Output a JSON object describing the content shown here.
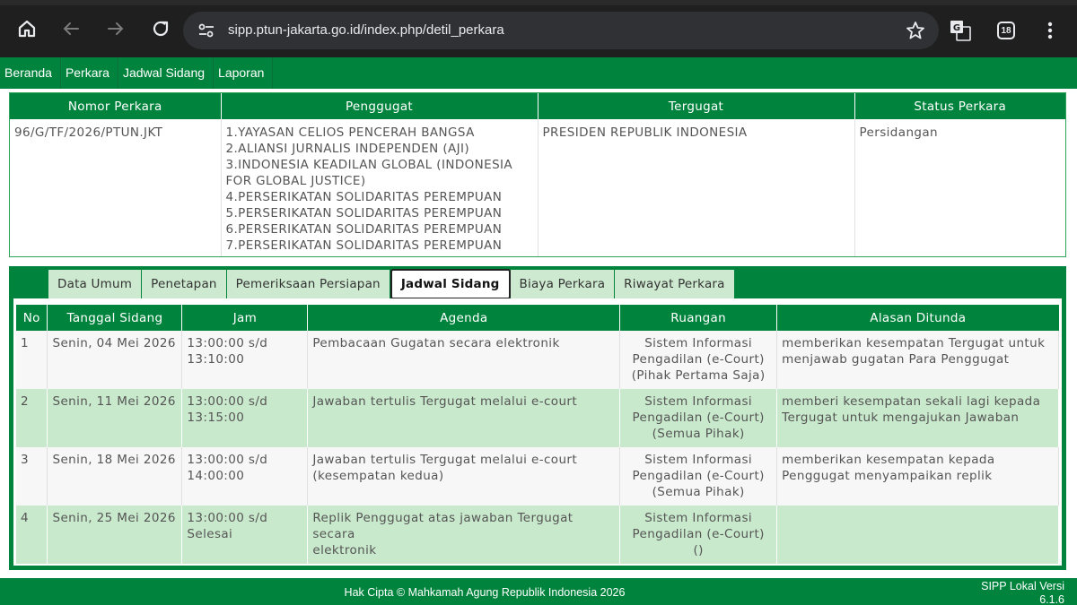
{
  "browser": {
    "url": "sipp.ptun-jakarta.go.id/index.php/detil_perkara",
    "tab_count": "18",
    "icons": [
      "home-icon",
      "back-icon",
      "forward-icon",
      "reload-icon",
      "site-settings-icon",
      "bookmark-star-icon",
      "translate-icon",
      "tab-count-icon",
      "menu-kebab-icon"
    ]
  },
  "nav": {
    "items": [
      "Beranda",
      "Perkara",
      "Jadwal Sidang",
      "Laporan"
    ]
  },
  "case": {
    "headers": [
      "Nomor Perkara",
      "Penggugat",
      "Tergugat",
      "Status Perkara"
    ],
    "nomor": "96/G/TF/2026/PTUN.JKT",
    "penggugat": [
      "1.YAYASAN CELIOS PENCERAH BANGSA",
      "2.ALIANSI JURNALIS INDEPENDEN (AJI)",
      "3.INDONESIA KEADILAN GLOBAL (INDONESIA",
      "FOR GLOBAL JUSTICE)",
      "4.PERSERIKATAN SOLIDARITAS PEREMPUAN",
      "5.PERSERIKATAN SOLIDARITAS PEREMPUAN",
      "6.PERSERIKATAN SOLIDARITAS PEREMPUAN",
      "7.PERSERIKATAN SOLIDARITAS PEREMPUAN"
    ],
    "tergugat": "PRESIDEN REPUBLIK INDONESIA",
    "status": "Persidangan"
  },
  "tabs": {
    "items": [
      "Data Umum",
      "Penetapan",
      "Pemeriksaan Persiapan",
      "Jadwal Sidang",
      "Biaya Perkara",
      "Riwayat Perkara"
    ],
    "active": "Jadwal Sidang"
  },
  "schedule": {
    "headers": [
      "No",
      "Tanggal Sidang",
      "Jam",
      "Agenda",
      "Ruangan",
      "Alasan Ditunda"
    ],
    "rows": [
      {
        "no": "1",
        "tanggal": "Senin, 04 Mei 2026",
        "jam": [
          "13:00:00 s/d",
          "13:10:00"
        ],
        "agenda": [
          "Pembacaan Gugatan secara elektronik"
        ],
        "ruangan": [
          "Sistem Informasi",
          "Pengadilan (e-Court)",
          "(Pihak Pertama Saja)"
        ],
        "alasan": [
          "memberikan kesempatan Tergugat untuk",
          "menjawab gugatan Para Penggugat"
        ]
      },
      {
        "no": "2",
        "tanggal": "Senin, 11 Mei 2026",
        "jam": [
          "13:00:00 s/d",
          "13:15:00"
        ],
        "agenda": [
          "Jawaban tertulis Tergugat melalui e-court"
        ],
        "ruangan": [
          "Sistem Informasi",
          "Pengadilan (e-Court)",
          "(Semua Pihak)"
        ],
        "alasan": [
          "memberi kesempatan sekali lagi kepada",
          "Tergugat untuk mengajukan Jawaban"
        ]
      },
      {
        "no": "3",
        "tanggal": "Senin, 18 Mei 2026",
        "jam": [
          "13:00:00 s/d",
          "14:00:00"
        ],
        "agenda": [
          "Jawaban tertulis Tergugat melalui e-court",
          "(kesempatan kedua)"
        ],
        "ruangan": [
          "Sistem Informasi",
          "Pengadilan (e-Court)",
          "(Semua Pihak)"
        ],
        "alasan": [
          "memberikan kesempatan kepada",
          "Penggugat menyampaikan replik"
        ]
      },
      {
        "no": "4",
        "tanggal": "Senin, 25 Mei 2026",
        "jam": [
          "13:00:00 s/d",
          "Selesai"
        ],
        "agenda": [
          "Replik Penggugat atas jawaban Tergugat secara",
          "elektronik"
        ],
        "ruangan": [
          "Sistem Informasi",
          "Pengadilan (e-Court)",
          "()"
        ],
        "alasan": []
      }
    ]
  },
  "footer": {
    "copyright": "Hak Cipta © Mahkamah Agung Republik Indonesia 2026",
    "version_line1": "SIPP Lokal Versi",
    "version_line2": "6.1.6"
  },
  "colors": {
    "brand_green": "#00843d",
    "row_green": "#c9e9cc",
    "tab_green": "#cde9cf",
    "chrome_dark": "#1f1f1f"
  }
}
